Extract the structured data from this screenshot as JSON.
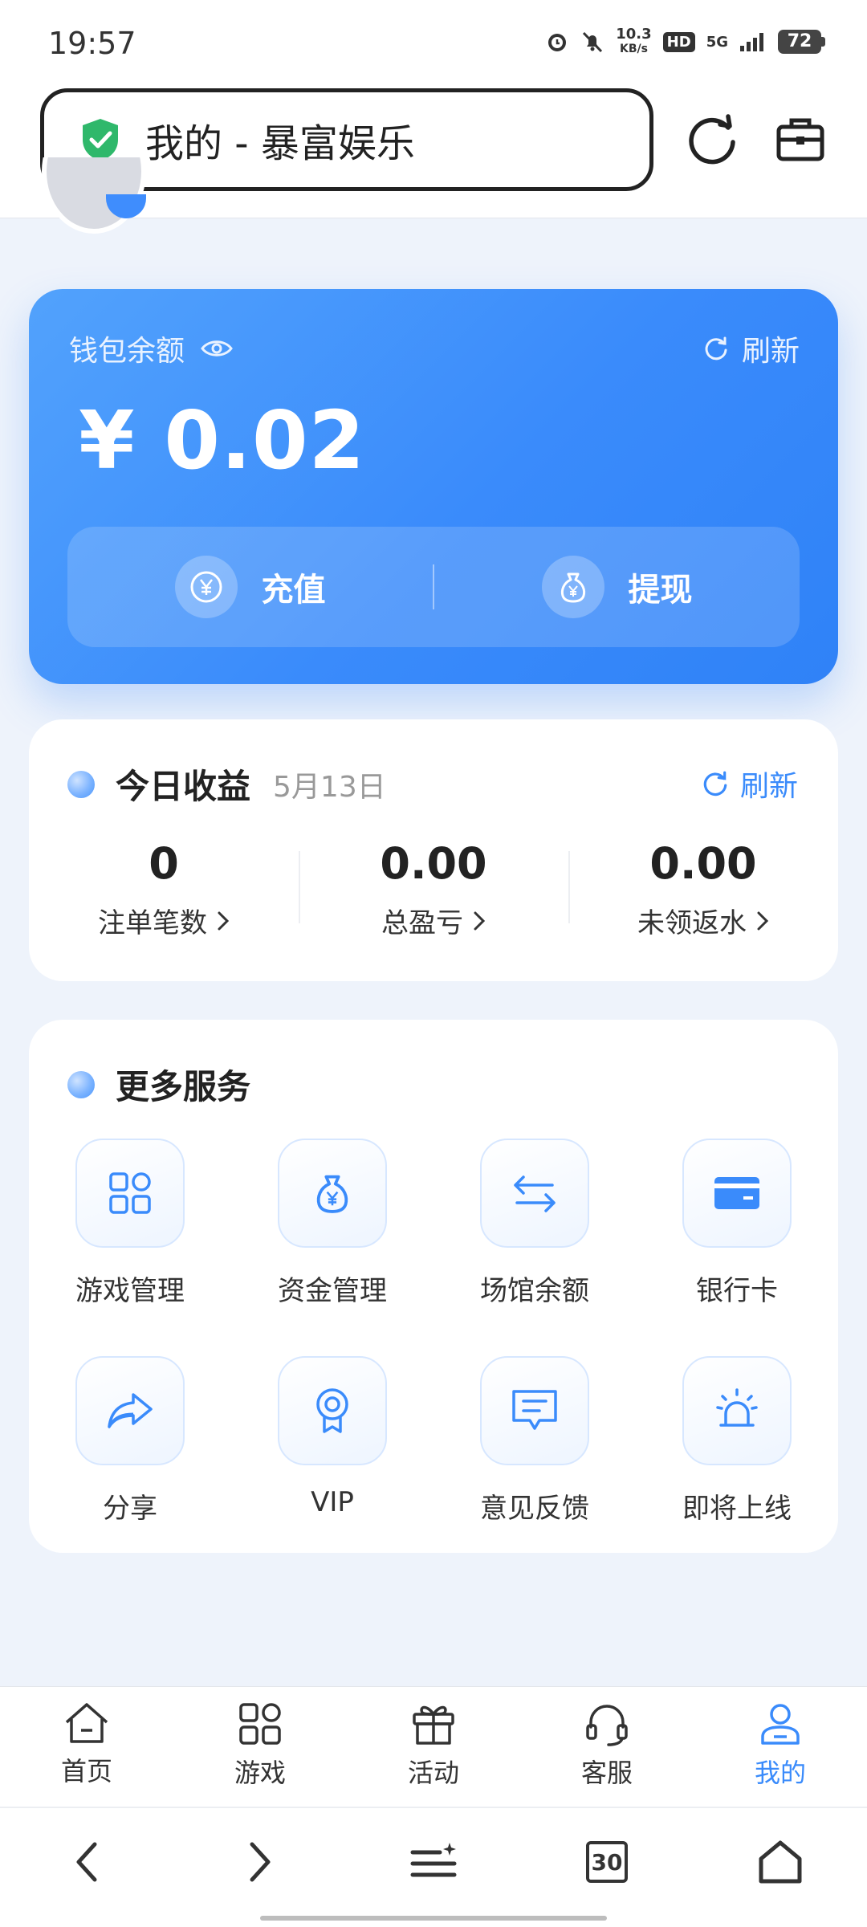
{
  "status_bar": {
    "time": "19:57",
    "net_speed_value": "10.3",
    "net_speed_unit": "KB/s",
    "hd": "HD",
    "network": "5G",
    "battery": "72"
  },
  "browser": {
    "page_title": "我的 - 暴富娱乐",
    "tab_count": "30"
  },
  "wallet": {
    "label": "钱包余额",
    "refresh_label": "刷新",
    "amount": "¥ 0.02",
    "recharge_label": "充值",
    "withdraw_label": "提现"
  },
  "earnings": {
    "title": "今日收益",
    "date": "5月13日",
    "refresh_label": "刷新",
    "stats": [
      {
        "value": "0",
        "label": "注单笔数"
      },
      {
        "value": "0.00",
        "label": "总盈亏"
      },
      {
        "value": "0.00",
        "label": "未领返水"
      }
    ]
  },
  "services": {
    "title": "更多服务",
    "items": [
      {
        "label": "游戏管理",
        "icon": "grid-icon"
      },
      {
        "label": "资金管理",
        "icon": "money-bag-icon"
      },
      {
        "label": "场馆余额",
        "icon": "transfer-icon"
      },
      {
        "label": "银行卡",
        "icon": "bank-card-icon"
      },
      {
        "label": "分享",
        "icon": "share-icon"
      },
      {
        "label": "VIP",
        "icon": "medal-icon"
      },
      {
        "label": "意见反馈",
        "icon": "feedback-icon"
      },
      {
        "label": "即将上线",
        "icon": "alarm-light-icon"
      }
    ]
  },
  "tab_bar": {
    "items": [
      {
        "label": "首页",
        "icon": "home-icon"
      },
      {
        "label": "游戏",
        "icon": "games-icon"
      },
      {
        "label": "活动",
        "icon": "gift-icon"
      },
      {
        "label": "客服",
        "icon": "headset-icon"
      },
      {
        "label": "我的",
        "icon": "user-icon",
        "active": true
      }
    ]
  },
  "colors": {
    "accent": "#3a8bfb",
    "wallet_gradient_start": "#52a2fc",
    "wallet_gradient_end": "#2f82f7",
    "shield_green": "#2fb86b"
  }
}
